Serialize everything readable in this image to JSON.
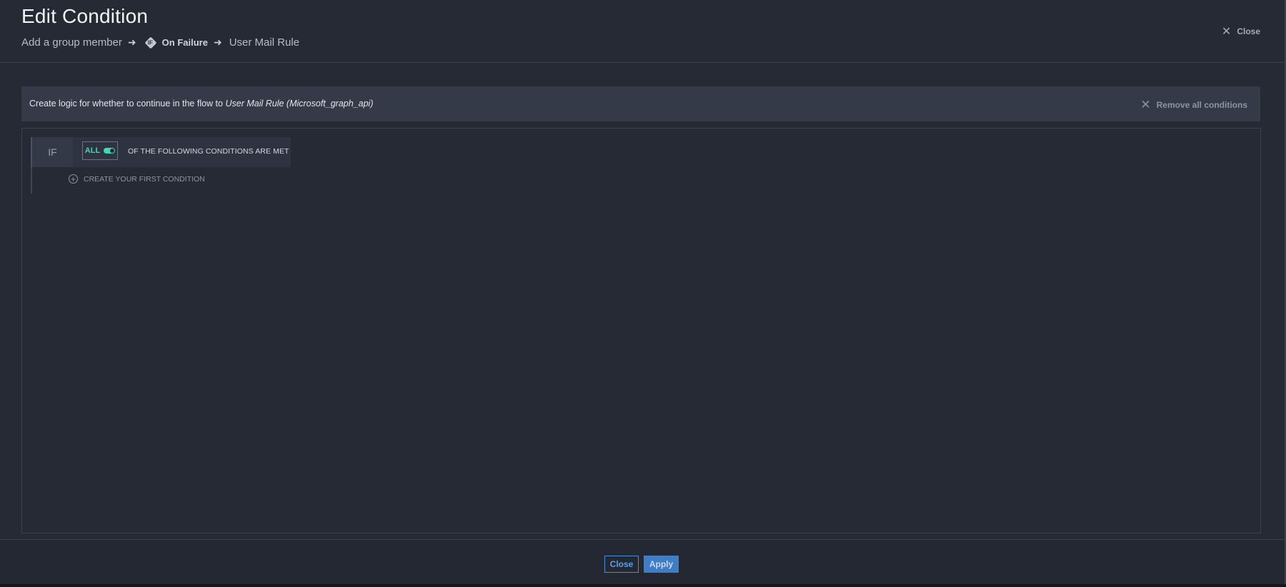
{
  "header": {
    "title": "Edit Condition",
    "breadcrumb": {
      "step1": "Add a group member",
      "condition_icon_letter": "IF",
      "step2": "On Failure",
      "step3": "User Mail Rule"
    },
    "close_label": "Close"
  },
  "info_bar": {
    "prefix": "Create logic for whether to continue in the flow to ",
    "target": "User Mail Rule (Microsoft_graph_api)",
    "remove_all_label": "Remove all conditions"
  },
  "builder": {
    "if_label": "IF",
    "mode_label": "ALL",
    "mode_toggle_on": true,
    "following_text": "OF THE FOLLOWING CONDITIONS ARE MET",
    "create_first_label": "CREATE YOUR FIRST CONDITION"
  },
  "footer": {
    "close_label": "Close",
    "apply_label": "Apply"
  },
  "colors": {
    "background": "#252a35",
    "accent_teal": "#3ddbb5",
    "primary_blue": "#3f7ec6"
  }
}
